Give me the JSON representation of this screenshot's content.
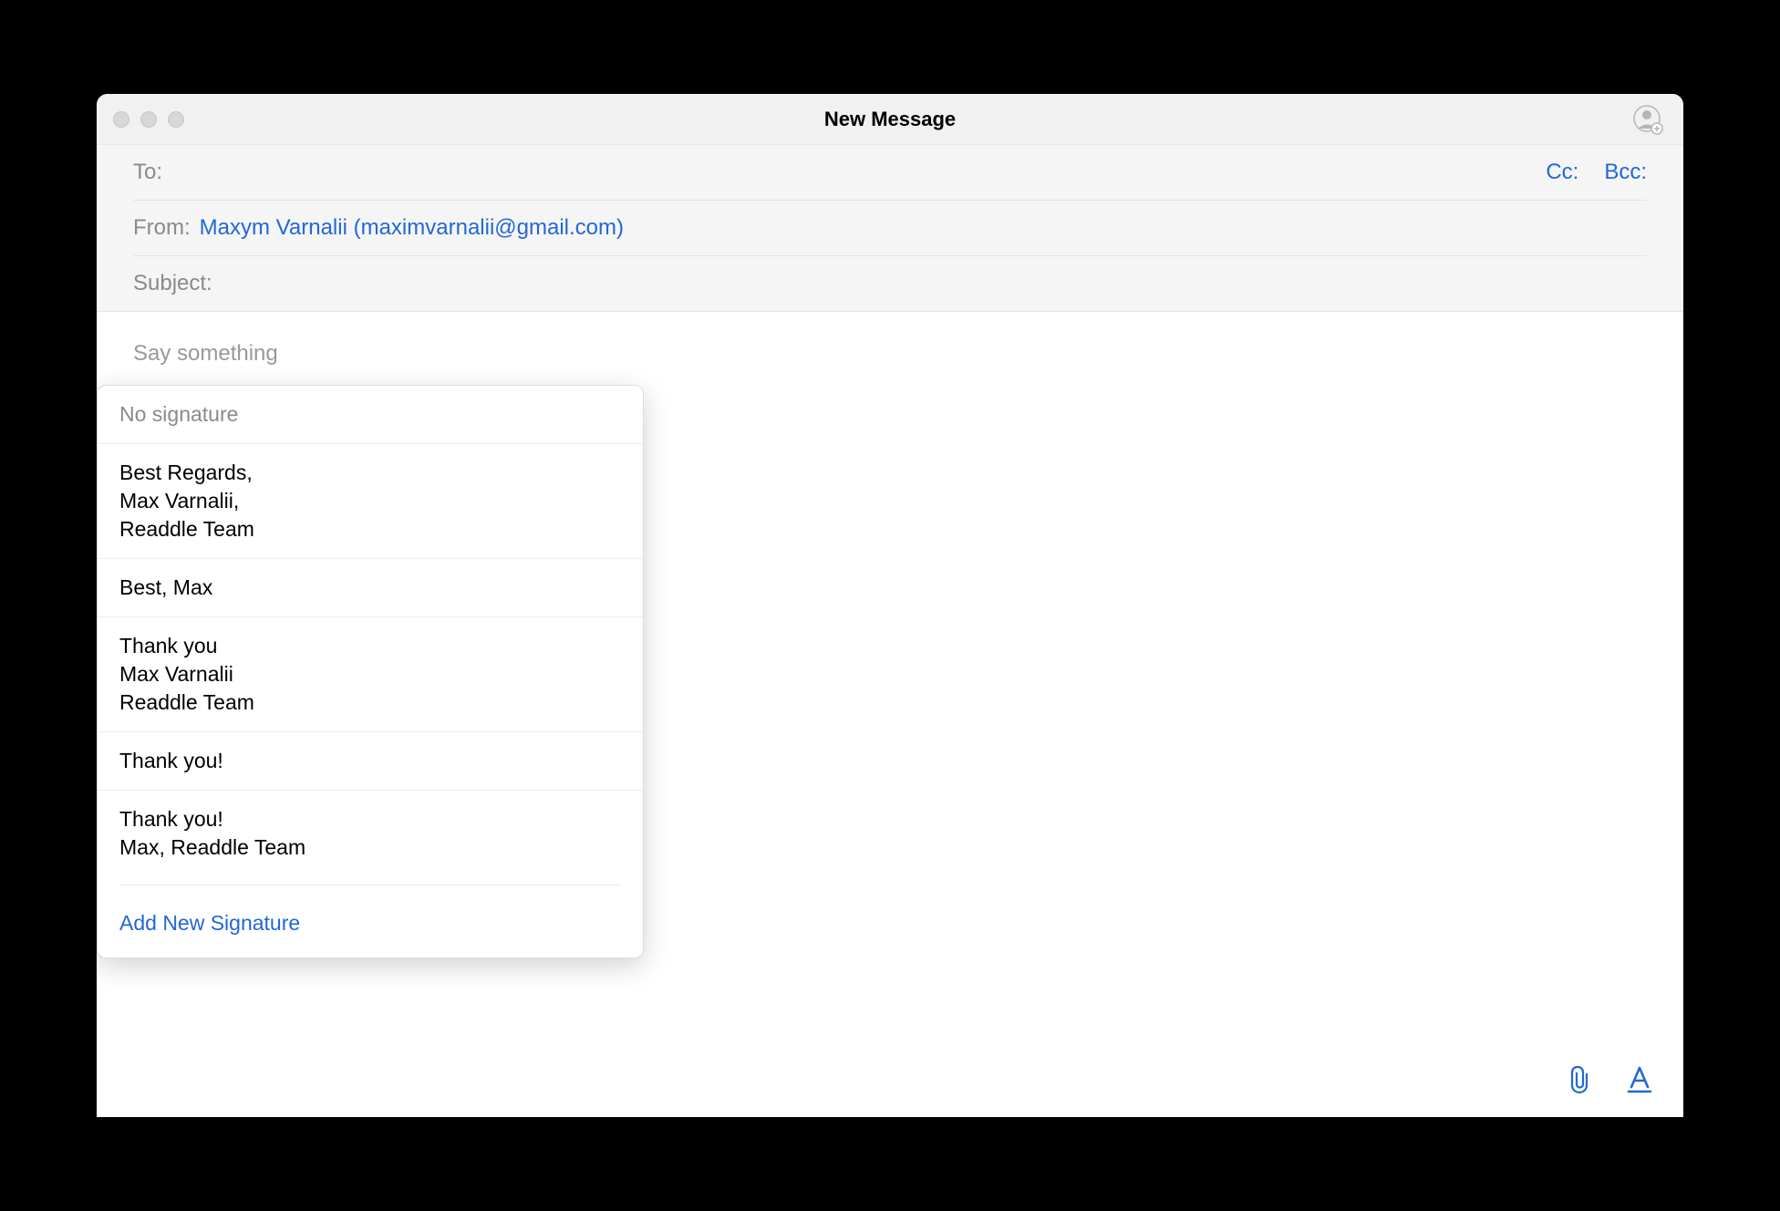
{
  "window": {
    "title": "New Message"
  },
  "fields": {
    "to_label": "To:",
    "from_label": "From:",
    "from_value": "Maxym Varnalii (maximvarnalii@gmail.com)",
    "subject_label": "Subject:",
    "cc_label": "Cc:",
    "bcc_label": "Bcc:"
  },
  "body": {
    "placeholder": "Say something"
  },
  "signature_popup": {
    "no_signature": "No signature",
    "items": [
      "Best Regards,\nMax Varnalii,\nReaddle Team",
      "Best, Max",
      "Thank you\nMax Varnalii\nReaddle Team",
      "Thank you!",
      "Thank you!\nMax, Readdle Team"
    ],
    "add_new": "Add New Signature"
  }
}
